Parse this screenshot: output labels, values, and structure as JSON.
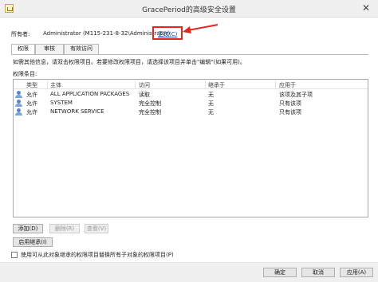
{
  "window": {
    "title": "GracePeriod的高级安全设置",
    "close_glyph": "✕"
  },
  "owner": {
    "label": "所有者:",
    "value": "Administrator (M115-231-8-32\\Administrator)",
    "change_link": "更改(C)"
  },
  "tabs": [
    {
      "label": "权限",
      "active": true
    },
    {
      "label": "审核",
      "active": false
    },
    {
      "label": "有效访问",
      "active": false
    }
  ],
  "description": "如需其他信息，请双击权限项目。若要修改权限项目，请选择该项目并单击\"编辑\"(如果可用)。",
  "entries_label": "权限条目:",
  "table": {
    "headers": [
      "类型",
      "主体",
      "访问",
      "继承于",
      "应用于"
    ],
    "rows": [
      {
        "icon": "user-group-icon",
        "type": "允许",
        "principal": "ALL APPLICATION PACKAGES",
        "access": "读取",
        "inherited_from": "无",
        "applies_to": "该项及其子项"
      },
      {
        "icon": "user-group-icon",
        "type": "允许",
        "principal": "SYSTEM",
        "access": "完全控制",
        "inherited_from": "无",
        "applies_to": "只有该项"
      },
      {
        "icon": "user-group-icon",
        "type": "允许",
        "principal": "NETWORK SERVICE",
        "access": "完全控制",
        "inherited_from": "无",
        "applies_to": "只有该项"
      }
    ]
  },
  "buttons": {
    "add": "添加(D)",
    "remove": "删除(R)",
    "view": "查看(V)",
    "enable_inheritance": "启用继承(I)",
    "ok": "确定",
    "cancel": "取消",
    "apply": "应用(A)"
  },
  "checkbox": {
    "label": "使用可从此对象继承的权限项目替换所有子对象的权限项目(P)",
    "checked": false
  },
  "colors": {
    "annotation": "#e0261f",
    "link": "#1b53b5"
  }
}
